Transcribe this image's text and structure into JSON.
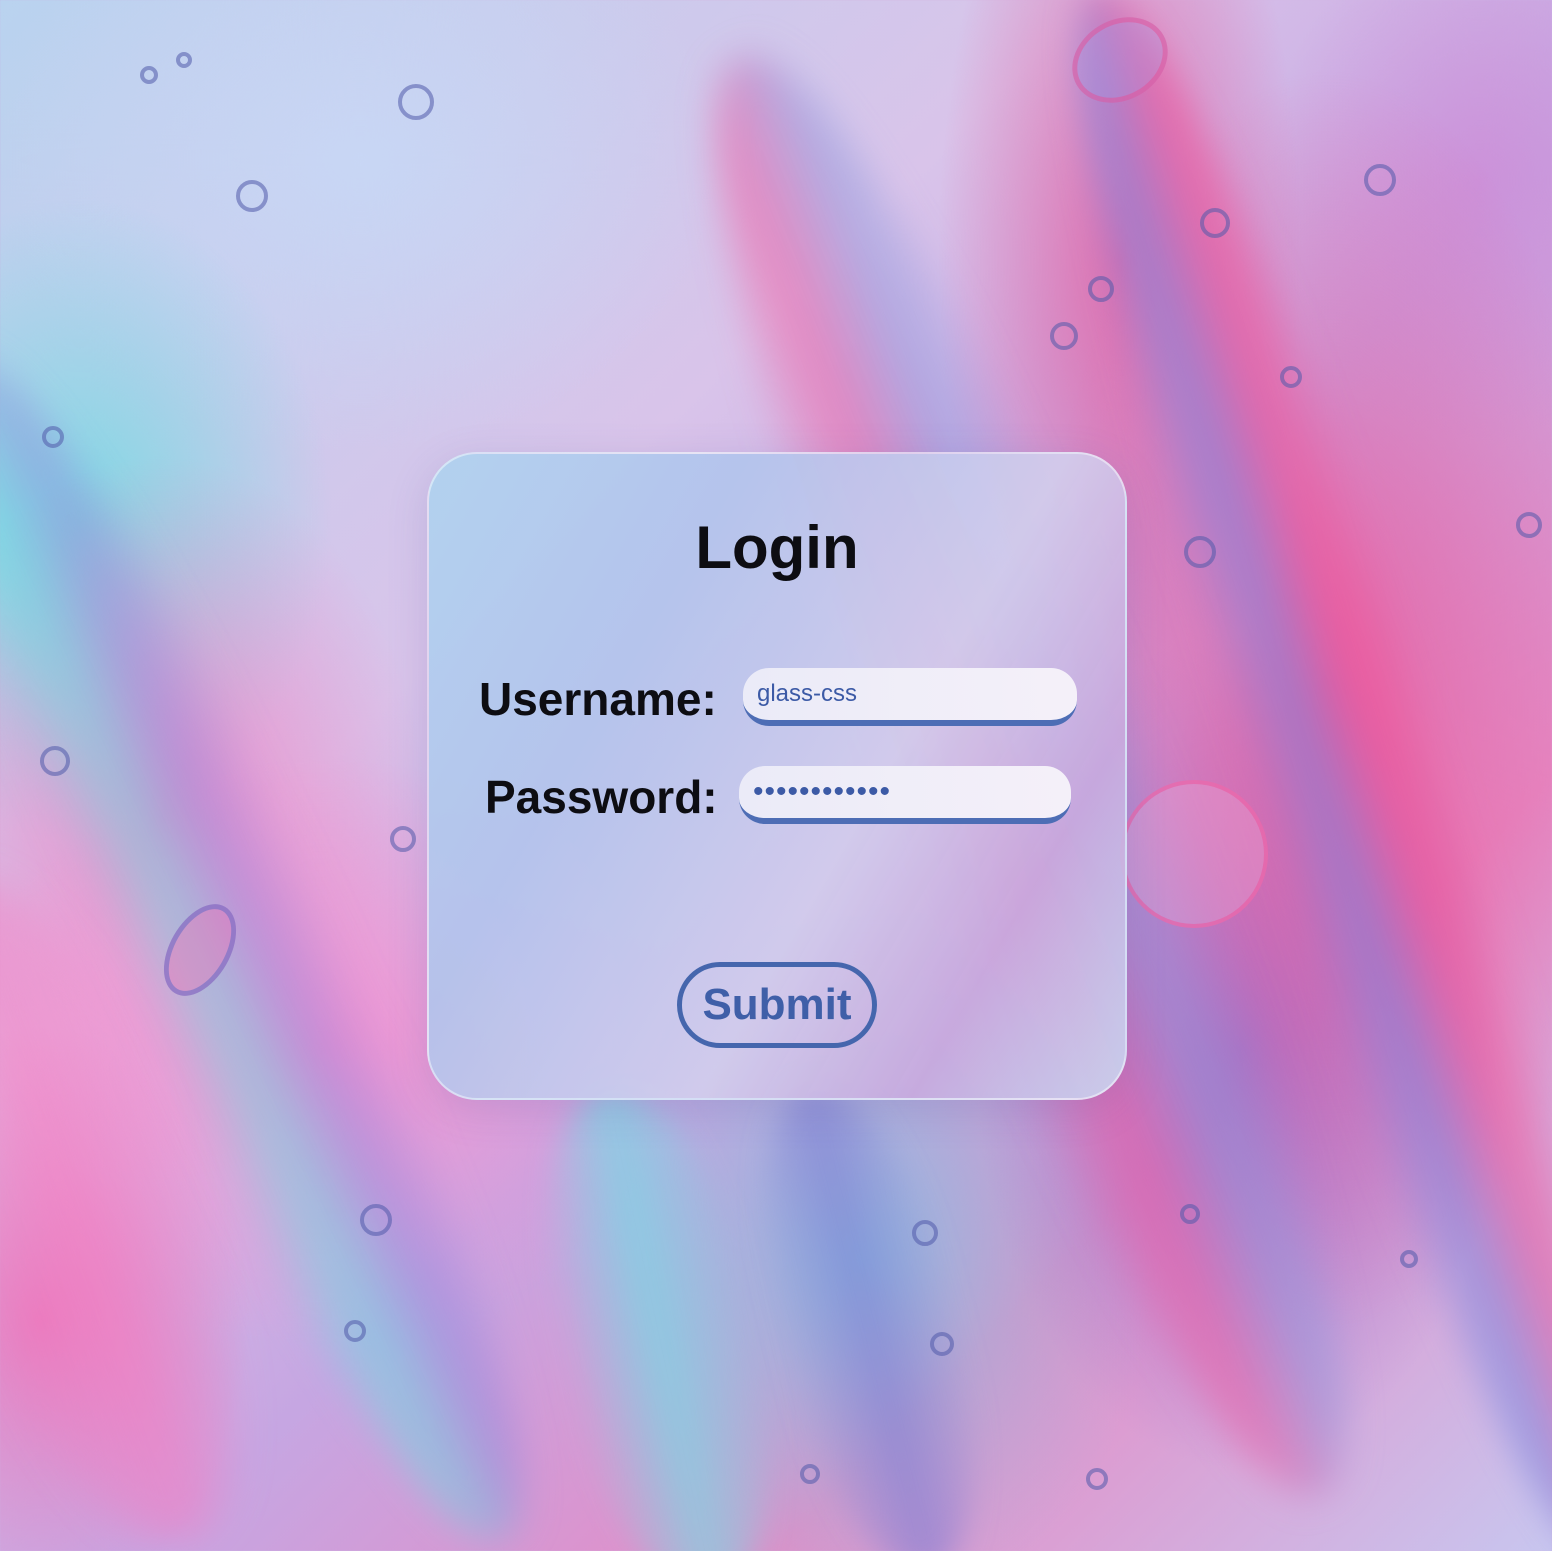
{
  "login_form": {
    "title": "Login",
    "username_label": "Username:",
    "username_value": "glass-css",
    "password_label": "Password:",
    "password_value": "••••••••••••",
    "submit_label": "Submit"
  },
  "colors": {
    "accent": "#4d6db5",
    "text": "#0d0d12",
    "background_pink": "#ec5496",
    "background_cyan": "#6edce1",
    "background_lavender": "#c6a6e2"
  }
}
